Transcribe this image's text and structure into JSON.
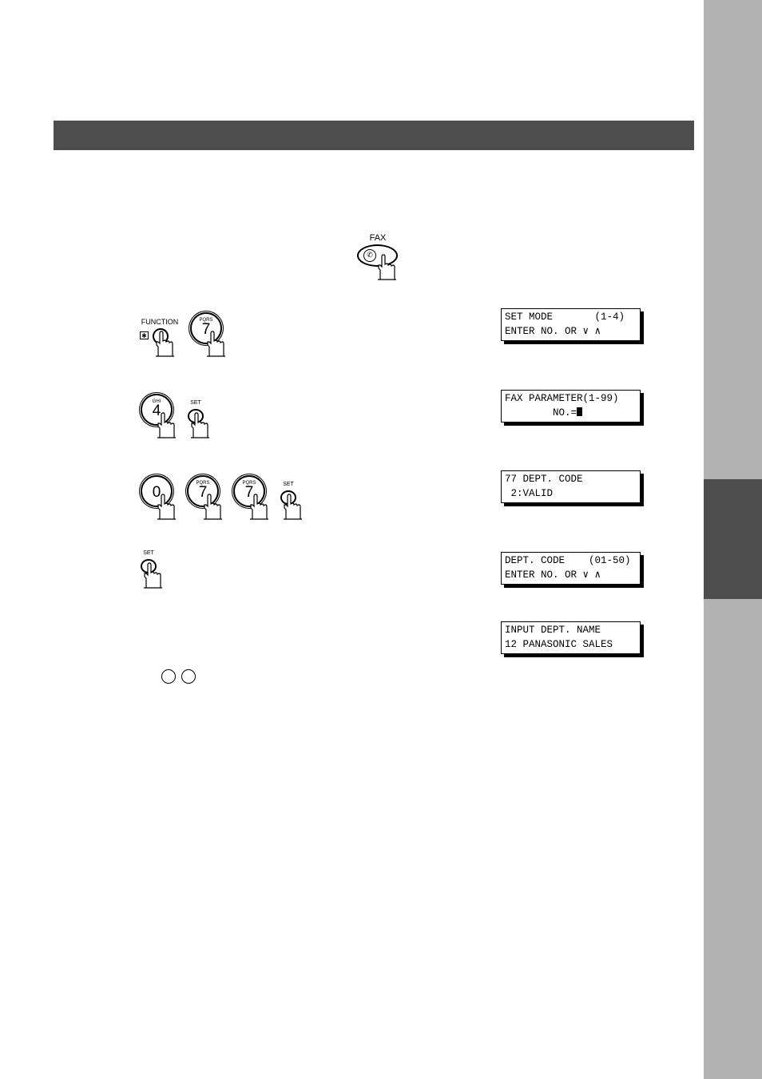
{
  "keys": {
    "fax_label": "FAX",
    "function_label": "FUNCTION",
    "star_symbol": "✱",
    "set_label": "SET",
    "key7_letters": "PQRS",
    "key7_digit": "7",
    "key4_letters": "GHI",
    "key4_digit": "4",
    "key0_digit": "0"
  },
  "displays": [
    {
      "line1": "SET MODE       (1-4)",
      "line2": "ENTER NO. OR ∨ ∧"
    },
    {
      "line1": "FAX PARAMETER(1-99)",
      "line2": "        NO.="
    },
    {
      "line1": "77 DEPT. CODE",
      "line2": " 2:VALID"
    },
    {
      "line1": "DEPT. CODE    (01-50)",
      "line2": "ENTER NO. OR ∨ ∧"
    },
    {
      "line1": "INPUT DEPT. NAME",
      "line2": "12 PANASONIC SALES"
    }
  ],
  "colors": {
    "header_bar": "#4d4d4d",
    "side_tab": "#b3b3b3",
    "side_tab_active": "#4d4d4d"
  }
}
